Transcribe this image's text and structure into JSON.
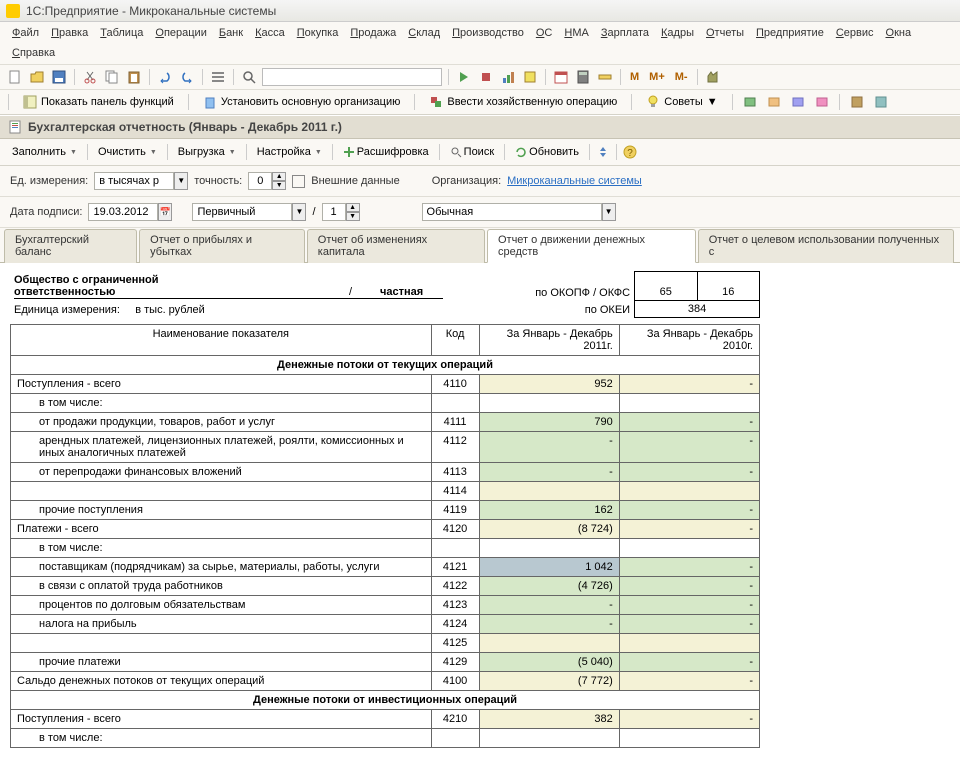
{
  "title": "1С:Предприятие - Микроканальные системы",
  "menu": [
    "Файл",
    "Правка",
    "Таблица",
    "Операции",
    "Банк",
    "Касса",
    "Покупка",
    "Продажа",
    "Склад",
    "Производство",
    "ОС",
    "НМА",
    "Зарплата",
    "Кадры",
    "Отчеты",
    "Предприятие",
    "Сервис",
    "Окна",
    "Справка"
  ],
  "toolbar2": {
    "showPanel": "Показать панель функций",
    "setOrg": "Установить основную организацию",
    "enterOp": "Ввести хозяйственную операцию",
    "tips": "Советы"
  },
  "mmText": {
    "m": "M",
    "mp": "M+",
    "mm": "M-"
  },
  "subheader": {
    "icon": "doc-icon",
    "text": "Бухгалтерская отчетность (Январь - Декабрь 2011 г.)"
  },
  "actions": {
    "fill": "Заполнить",
    "clear": "Очистить",
    "export": "Выгрузка",
    "settings": "Настройка",
    "decode": "Расшифровка",
    "search": "Поиск",
    "refresh": "Обновить"
  },
  "params": {
    "unitLabel": "Ед. измерения:",
    "unitValue": "в тысячах р",
    "precisionLabel": "точность:",
    "precisionValue": "0",
    "externalLabel": "Внешние данные",
    "orgLabel": "Организация:",
    "orgValue": "Микроканальные системы",
    "signDateLabel": "Дата подписи:",
    "signDateValue": "19.03.2012",
    "primaryValue": "Первичный",
    "correctionValue": "1",
    "typeValue": "Обычная"
  },
  "tabs": [
    {
      "label": "Бухгалтерский баланс",
      "active": false
    },
    {
      "label": "Отчет о прибылях и убытках",
      "active": false
    },
    {
      "label": "Отчет об изменениях капитала",
      "active": false
    },
    {
      "label": "Отчет о движении денежных средств",
      "active": true
    },
    {
      "label": "Отчет о целевом использовании полученных с",
      "active": false
    }
  ],
  "header": {
    "orgLine1": "Общество с ограниченной",
    "orgLine2": "ответственностью",
    "orgType": "частная",
    "units": "Единица измерения:",
    "unitsVal": "в тыс. рублей",
    "okopf": "по ОКОПФ / ОКФС",
    "okopfVal": "65",
    "okfsVal": "16",
    "okei": "по ОКЕИ",
    "okeiVal": "384"
  },
  "tableHeaders": {
    "name": "Наименование показателя",
    "code": "Код",
    "period1": "За Январь - Декабрь 2011г.",
    "period2": "За Январь - Декабрь 2010г."
  },
  "rows": [
    {
      "type": "section",
      "name": "Денежные потоки от текущих операций"
    },
    {
      "name": "Поступления - всего",
      "code": "4110",
      "v1": "952",
      "v2": "-",
      "c1": "calc",
      "c2": "calc"
    },
    {
      "name": "в том числе:",
      "indent": 1
    },
    {
      "name": "от продажи продукции, товаров, работ и услуг",
      "code": "4111",
      "v1": "790",
      "v2": "-",
      "c1": "edit",
      "c2": "edit",
      "indent": 1
    },
    {
      "name": "арендных платежей, лицензионных платежей, роялти, комиссионных и иных аналогичных платежей",
      "code": "4112",
      "v1": "-",
      "v2": "-",
      "c1": "edit",
      "c2": "edit",
      "indent": 1
    },
    {
      "name": "от перепродажи финансовых вложений",
      "code": "4113",
      "v1": "-",
      "v2": "-",
      "c1": "edit",
      "c2": "edit",
      "indent": 1
    },
    {
      "name": "",
      "code": "4114",
      "v1": "",
      "v2": "",
      "c1": "calc",
      "c2": "calc",
      "indent": 1
    },
    {
      "name": "прочие поступления",
      "code": "4119",
      "v1": "162",
      "v2": "-",
      "c1": "edit",
      "c2": "edit",
      "indent": 1
    },
    {
      "name": "Платежи - всего",
      "code": "4120",
      "v1": "(8 724)",
      "v2": "-",
      "c1": "calc",
      "c2": "calc"
    },
    {
      "name": "в том числе:",
      "indent": 1
    },
    {
      "name": "поставщикам (подрядчикам) за сырье, материалы, работы, услуги",
      "code": "4121",
      "v1": "1 042",
      "v2": "-",
      "c1": "sel",
      "c2": "edit",
      "indent": 1
    },
    {
      "name": "в связи с оплатой труда работников",
      "code": "4122",
      "v1": "(4 726)",
      "v2": "-",
      "c1": "edit",
      "c2": "edit",
      "indent": 1
    },
    {
      "name": "процентов по долговым обязательствам",
      "code": "4123",
      "v1": "-",
      "v2": "-",
      "c1": "edit",
      "c2": "edit",
      "indent": 1
    },
    {
      "name": "налога на прибыль",
      "code": "4124",
      "v1": "-",
      "v2": "-",
      "c1": "edit",
      "c2": "edit",
      "indent": 1
    },
    {
      "name": "",
      "code": "4125",
      "v1": "",
      "v2": "",
      "c1": "calc",
      "c2": "calc",
      "indent": 1
    },
    {
      "name": "прочие платежи",
      "code": "4129",
      "v1": "(5 040)",
      "v2": "-",
      "c1": "edit",
      "c2": "edit",
      "indent": 1
    },
    {
      "name": "Сальдо денежных потоков от текущих операций",
      "code": "4100",
      "v1": "(7 772)",
      "v2": "-",
      "c1": "calc",
      "c2": "calc"
    },
    {
      "type": "section",
      "name": "Денежные потоки от инвестиционных операций"
    },
    {
      "name": "Поступления - всего",
      "code": "4210",
      "v1": "382",
      "v2": "-",
      "c1": "calc",
      "c2": "calc"
    },
    {
      "name": "в том числе:",
      "indent": 1
    }
  ]
}
